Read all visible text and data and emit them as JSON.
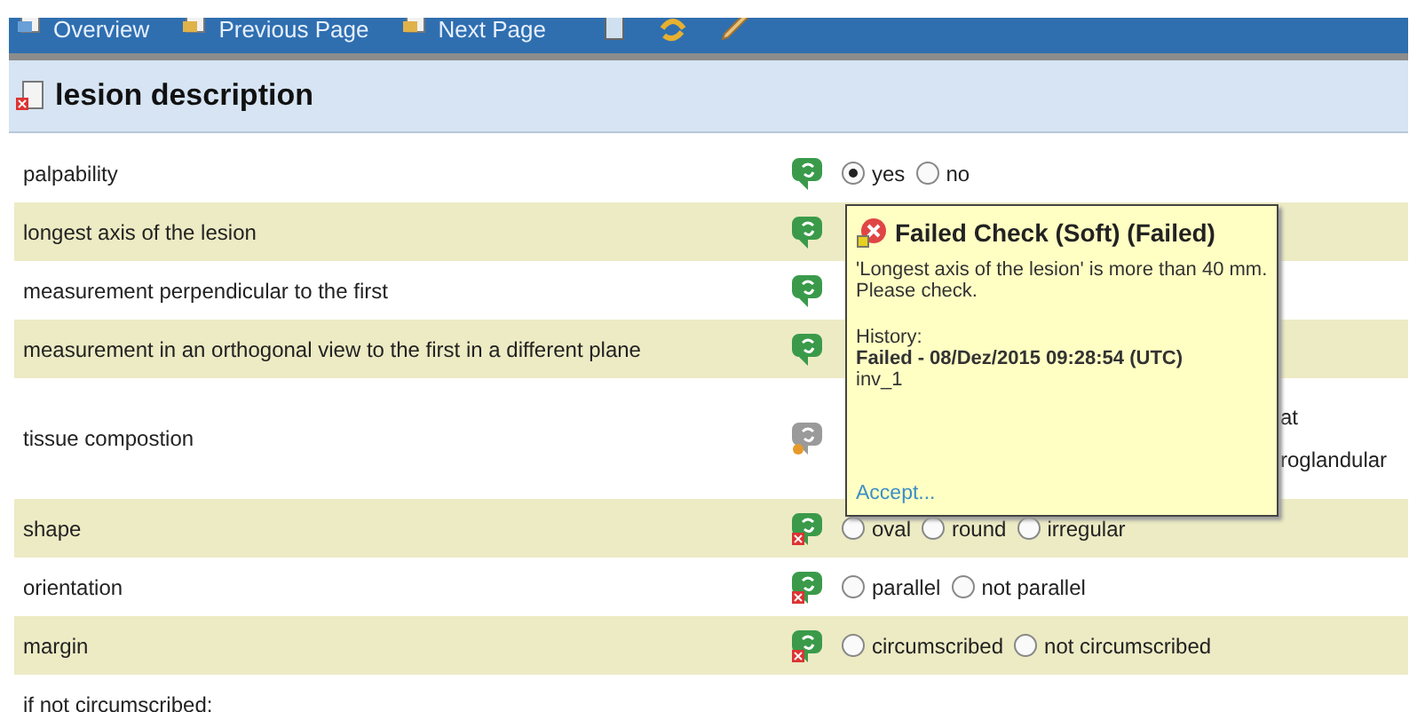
{
  "toolbar": {
    "items": [
      {
        "label": "Overview",
        "kind": "overview"
      },
      {
        "label": "Previous Page",
        "kind": "previous"
      },
      {
        "label": "Next Page",
        "kind": "next"
      }
    ]
  },
  "section": {
    "title": "lesion description",
    "kind": "error"
  },
  "rows": [
    {
      "label": "palpability",
      "kind": "ok",
      "options": [
        {
          "label": "yes",
          "selected": true
        },
        {
          "label": "no",
          "selected": false
        }
      ]
    },
    {
      "label": "longest axis of the lesion",
      "kind": "ok"
    },
    {
      "label": "measurement perpendicular to the first",
      "kind": "ok"
    },
    {
      "label": "measurement in an orthogonal view to the first in a different plane",
      "kind": "ok"
    },
    {
      "label": "tissue compostion",
      "kind": "warning",
      "fragments": [
        "at",
        "roglandular"
      ]
    },
    {
      "label": "shape",
      "kind": "error",
      "options": [
        {
          "label": "oval",
          "selected": false
        },
        {
          "label": "round",
          "selected": false
        },
        {
          "label": "irregular",
          "selected": false
        }
      ]
    },
    {
      "label": "orientation",
      "kind": "error",
      "options": [
        {
          "label": "parallel",
          "selected": false
        },
        {
          "label": "not parallel",
          "selected": false
        }
      ]
    },
    {
      "label": "margin",
      "kind": "error",
      "options": [
        {
          "label": "circumscribed",
          "selected": false
        },
        {
          "label": "not circumscribed",
          "selected": false
        }
      ]
    },
    {
      "label": "if not circumscribed:"
    }
  ],
  "tooltip": {
    "title": "Failed Check (Soft) (Failed)",
    "message": "'Longest axis of the lesion' is more than 40 mm. Please check.",
    "history_label": "History:",
    "history_entry": "Failed - 08/Dez/2015 09:28:54 (UTC)",
    "user": "inv_1",
    "action": "Accept..."
  }
}
